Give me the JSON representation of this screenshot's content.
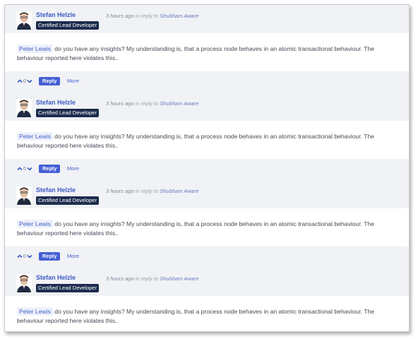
{
  "posts": [
    {
      "author": "Stefan Helzle",
      "badge": "Certified Lead Developer",
      "time": "3 hours ago",
      "in_reply_to": "in reply to",
      "reply_target": "Shubham Aware",
      "mention": "Peter Lewis",
      "text": "do you have any insights? My understanding is, that a process node behaves in an atomic transactional behaviour. The behaviour reported here violates this..",
      "vote_count": "0",
      "reply_label": "Reply",
      "more_label": "More"
    },
    {
      "author": "Stefan Helzle",
      "badge": "Certified Lead Developer",
      "time": "3 hours ago",
      "in_reply_to": "in reply to",
      "reply_target": "Shubham Aware",
      "mention": "Peter Lewis",
      "text": "do you have any insights? My understanding is, that a process node behaves in an atomic transactional behaviour. The behaviour reported here violates this..",
      "vote_count": "0",
      "reply_label": "Reply",
      "more_label": "More"
    },
    {
      "author": "Stefan Helzle",
      "badge": "Certified Lead Developer",
      "time": "3 hours ago",
      "in_reply_to": "in reply to",
      "reply_target": "Shubham Aware",
      "mention": "Peter Lewis",
      "text": "do you have any insights? My understanding is, that a process node behaves in an atomic transactional behaviour. The behaviour reported here violates this..",
      "vote_count": "0",
      "reply_label": "Reply",
      "more_label": "More"
    },
    {
      "author": "Stefan Helzle",
      "badge": "Certified Lead Developer",
      "time": "3 hours ago",
      "in_reply_to": "in reply to",
      "reply_target": "Shubham Aware",
      "mention": "Peter Lewis",
      "text": "do you have any insights? My understanding is, that a process node behaves in an atomic transactional behaviour. The behaviour reported here violates this.."
    }
  ],
  "colors": {
    "accent": "#4660d4",
    "badge_bg": "#1d2c4e",
    "header_bg": "#f1f2f6"
  },
  "icons": {
    "avatar": "avatar",
    "upvote": "chevron-up-icon",
    "downvote": "chevron-down-icon"
  }
}
